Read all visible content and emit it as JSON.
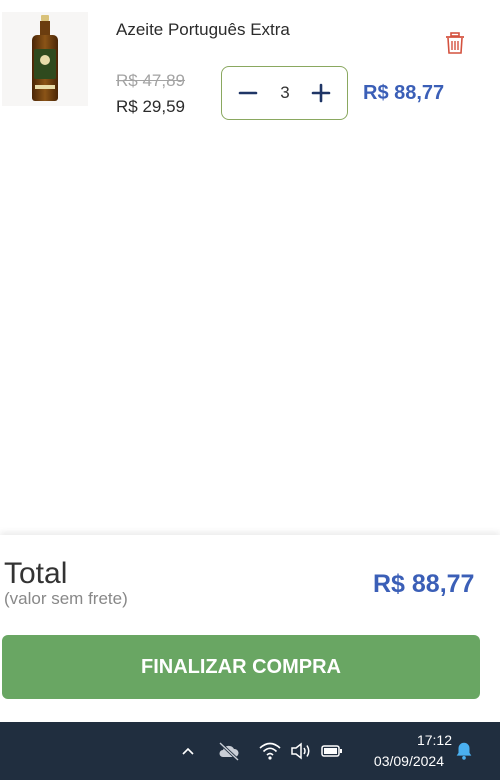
{
  "cart": {
    "items": [
      {
        "name": "Azeite Português Extra",
        "old_price": "R$ 47,89",
        "unit_price": "R$ 29,59",
        "quantity": "3",
        "line_total": "R$ 88,77"
      }
    ]
  },
  "summary": {
    "total_label": "Total",
    "total_sub": "(valor sem frete)",
    "total_value": "R$ 88,77",
    "checkout_label": "FINALIZAR COMPRA"
  },
  "taskbar": {
    "time": "17:12",
    "date": "03/09/2024"
  },
  "colors": {
    "accent_blue": "#3b5fb7",
    "checkout_green": "#69a663",
    "stepper_border": "#8aa860",
    "trash_red": "#d4523f",
    "taskbar_bg": "#202e3f",
    "bell": "#4ab0f0"
  },
  "icons": [
    "trash-icon",
    "minus-icon",
    "plus-icon",
    "chevron-up-icon",
    "cloud-off-icon",
    "wifi-icon",
    "speaker-icon",
    "battery-icon",
    "bell-icon"
  ]
}
